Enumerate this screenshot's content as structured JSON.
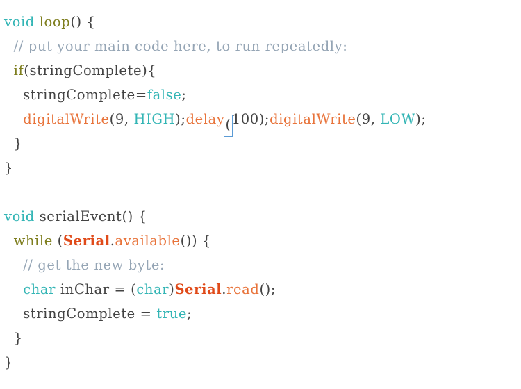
{
  "editor": {
    "name": "arduino-code-view",
    "background": "#ffffff",
    "font_size_px": 19.5,
    "line_height_px": 35,
    "colors": {
      "type_keyword": "#33b5b5",
      "control_keyword": "#7e7e1e",
      "plain_text": "#434343",
      "comment": "#95a5b5",
      "function": "#e8733a",
      "class_name": "#e04a19",
      "paren_highlight_border": "#5b9bd5"
    },
    "bracket_highlight": {
      "character": "(",
      "after_token": "delay",
      "line_index": 4
    }
  },
  "code": {
    "lines": [
      {
        "index": 0,
        "text": "void loop() {",
        "tokens": [
          {
            "t": "void",
            "c": "type"
          },
          {
            "t": " ",
            "c": "plain"
          },
          {
            "t": "loop",
            "c": "keyword"
          },
          {
            "t": "() {",
            "c": "plain"
          }
        ]
      },
      {
        "index": 1,
        "text": "  // put your main code here, to run repeatedly:",
        "tokens": [
          {
            "t": "  ",
            "c": "plain"
          },
          {
            "t": "// put your main code here, to run repeatedly:",
            "c": "comment"
          }
        ]
      },
      {
        "index": 2,
        "text": "  if(stringComplete){",
        "tokens": [
          {
            "t": "  ",
            "c": "plain"
          },
          {
            "t": "if",
            "c": "keyword"
          },
          {
            "t": "(stringComplete){",
            "c": "plain"
          }
        ]
      },
      {
        "index": 3,
        "text": "    stringComplete=false;",
        "tokens": [
          {
            "t": "    stringComplete=",
            "c": "plain"
          },
          {
            "t": "false",
            "c": "type"
          },
          {
            "t": ";",
            "c": "plain"
          }
        ]
      },
      {
        "index": 4,
        "text": "    digitalWrite(9, HIGH);delay(100);digitalWrite(9, LOW);",
        "tokens": [
          {
            "t": "    ",
            "c": "plain"
          },
          {
            "t": "digitalWrite",
            "c": "func"
          },
          {
            "t": "(9, ",
            "c": "plain"
          },
          {
            "t": "HIGH",
            "c": "type"
          },
          {
            "t": ");",
            "c": "plain"
          },
          {
            "t": "delay",
            "c": "func"
          },
          {
            "t": "(",
            "c": "paren-hl"
          },
          {
            "t": "100);",
            "c": "plain"
          },
          {
            "t": "digitalWrite",
            "c": "func"
          },
          {
            "t": "(9, ",
            "c": "plain"
          },
          {
            "t": "LOW",
            "c": "type"
          },
          {
            "t": ");",
            "c": "plain"
          }
        ]
      },
      {
        "index": 5,
        "text": "  }",
        "tokens": [
          {
            "t": "  }",
            "c": "plain"
          }
        ]
      },
      {
        "index": 6,
        "text": "}",
        "tokens": [
          {
            "t": "}",
            "c": "plain"
          }
        ]
      },
      {
        "index": 7,
        "text": "",
        "tokens": []
      },
      {
        "index": 8,
        "text": "void serialEvent() {",
        "tokens": [
          {
            "t": "void",
            "c": "type"
          },
          {
            "t": " serialEvent() {",
            "c": "plain"
          }
        ]
      },
      {
        "index": 9,
        "text": "  while (Serial.available()) {",
        "tokens": [
          {
            "t": "  ",
            "c": "plain"
          },
          {
            "t": "while",
            "c": "keyword"
          },
          {
            "t": " (",
            "c": "plain"
          },
          {
            "t": "Serial",
            "c": "class"
          },
          {
            "t": ".",
            "c": "plain"
          },
          {
            "t": "available",
            "c": "func"
          },
          {
            "t": "()) {",
            "c": "plain"
          }
        ]
      },
      {
        "index": 10,
        "text": "    // get the new byte:",
        "tokens": [
          {
            "t": "    ",
            "c": "plain"
          },
          {
            "t": "// get the new byte:",
            "c": "comment"
          }
        ]
      },
      {
        "index": 11,
        "text": "    char inChar = (char)Serial.read();",
        "tokens": [
          {
            "t": "    ",
            "c": "plain"
          },
          {
            "t": "char",
            "c": "type"
          },
          {
            "t": " inChar = (",
            "c": "plain"
          },
          {
            "t": "char",
            "c": "type"
          },
          {
            "t": ")",
            "c": "plain"
          },
          {
            "t": "Serial",
            "c": "class"
          },
          {
            "t": ".",
            "c": "plain"
          },
          {
            "t": "read",
            "c": "func"
          },
          {
            "t": "();",
            "c": "plain"
          }
        ]
      },
      {
        "index": 12,
        "text": "    stringComplete = true;",
        "tokens": [
          {
            "t": "    stringComplete = ",
            "c": "plain"
          },
          {
            "t": "true",
            "c": "type"
          },
          {
            "t": ";",
            "c": "plain"
          }
        ]
      },
      {
        "index": 13,
        "text": "  }",
        "tokens": [
          {
            "t": "  }",
            "c": "plain"
          }
        ]
      },
      {
        "index": 14,
        "text": "}",
        "tokens": [
          {
            "t": "}",
            "c": "plain"
          }
        ]
      }
    ]
  }
}
